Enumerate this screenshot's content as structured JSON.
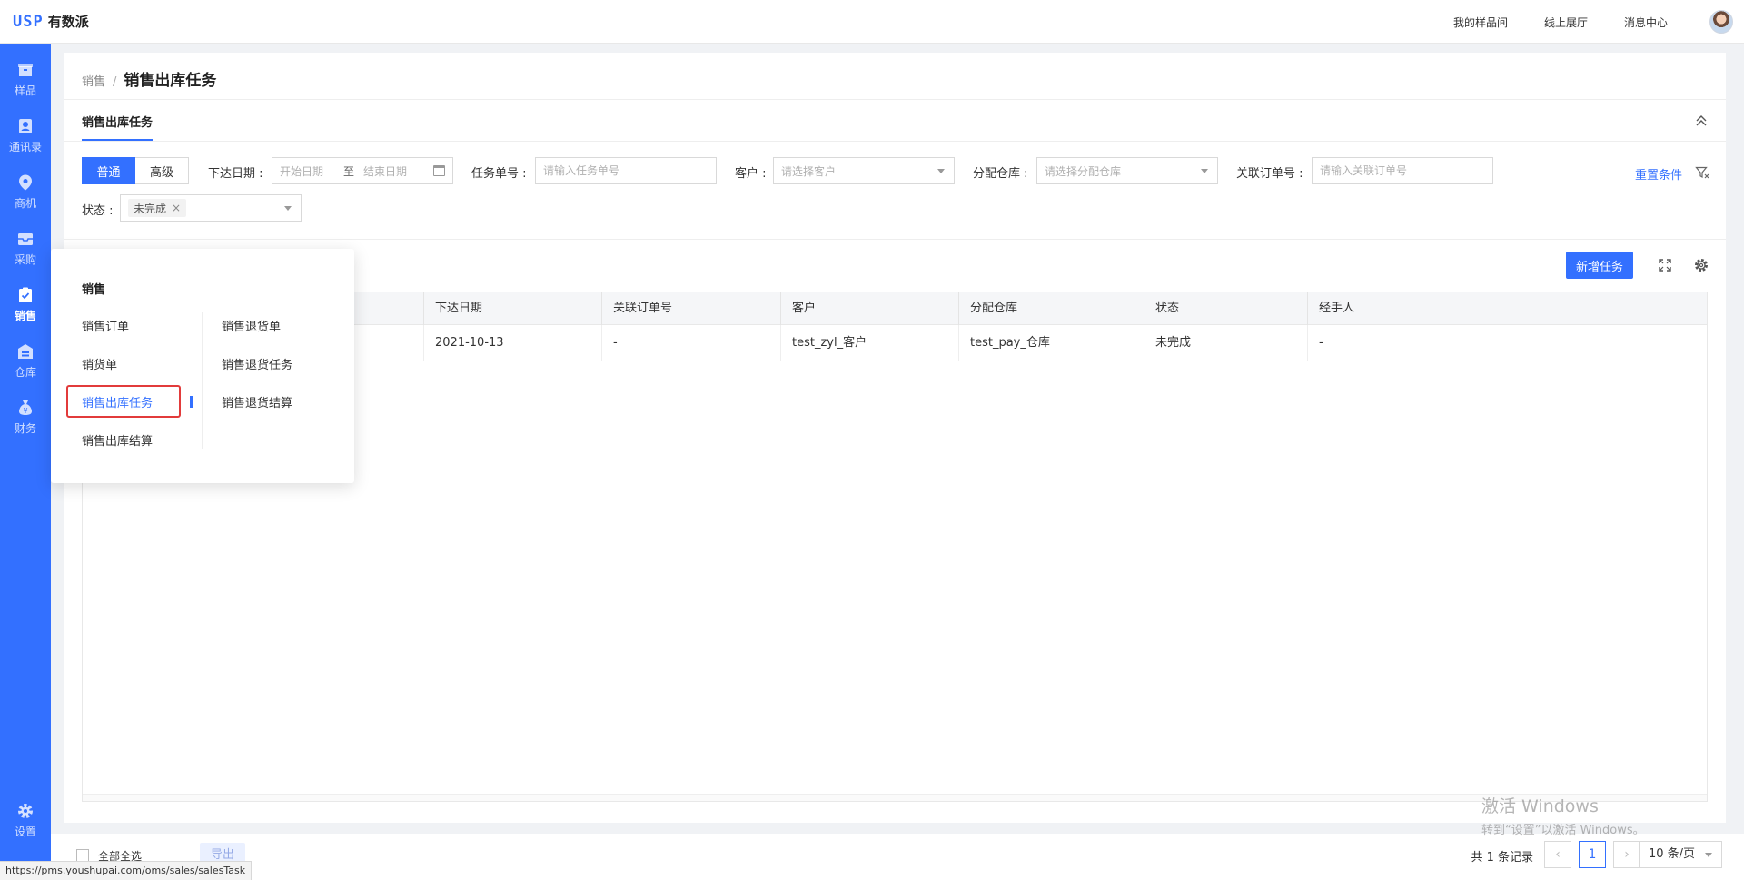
{
  "header": {
    "logo_mark": "USP",
    "logo_text": "有数派",
    "links": [
      "我的样品间",
      "线上展厅",
      "消息中心"
    ]
  },
  "sidebar": {
    "items": [
      {
        "label": "样品",
        "icon": "box-icon"
      },
      {
        "label": "通讯录",
        "icon": "contacts-icon"
      },
      {
        "label": "商机",
        "icon": "location-pin-icon"
      },
      {
        "label": "采购",
        "icon": "inbox-icon"
      },
      {
        "label": "销售",
        "icon": "clipboard-check-icon",
        "active": true
      },
      {
        "label": "仓库",
        "icon": "warehouse-icon"
      },
      {
        "label": "财务",
        "icon": "money-bag-icon"
      }
    ],
    "settings_label": "设置"
  },
  "breadcrumb": {
    "parent": "销售",
    "separator": "/",
    "current": "销售出库任务"
  },
  "tab": {
    "label": "销售出库任务"
  },
  "filters": {
    "mode_normal": "普通",
    "mode_advanced": "高级",
    "issue_date_label": "下达日期 :",
    "start_placeholder": "开始日期",
    "range_sep": "至",
    "end_placeholder": "结束日期",
    "task_no_label": "任务单号 :",
    "task_no_placeholder": "请输入任务单号",
    "customer_label": "客户 :",
    "customer_placeholder": "请选择客户",
    "warehouse_label": "分配仓库 :",
    "warehouse_placeholder": "请选择分配仓库",
    "order_no_label": "关联订单号 :",
    "order_no_placeholder": "请输入关联订单号",
    "status_label": "状态 :",
    "status_tag": "未完成",
    "status_tag_remove": "×",
    "reset_label": "重置条件"
  },
  "toolbar": {
    "add_task_label": "新增任务"
  },
  "table": {
    "columns": [
      "下达日期",
      "关联订单号",
      "客户",
      "分配仓库",
      "状态",
      "经手人"
    ],
    "rows": [
      [
        "2021-10-13",
        "-",
        "test_zyl_客户",
        "test_pay_仓库",
        "未完成",
        "-"
      ]
    ]
  },
  "footer": {
    "select_all_label": "全部全选",
    "export_label": "导出",
    "total_text": "共 1 条记录",
    "prev": "‹",
    "next": "›",
    "current_page": "1",
    "page_size": "10 条/页"
  },
  "flyout": {
    "title": "销售",
    "left_items": [
      "销售订单",
      "销货单",
      "销售出库任务",
      "销售出库结算"
    ],
    "right_items": [
      "销售退货单",
      "销售退货任务",
      "销售退货结算"
    ],
    "active_item": "销售出库任务"
  },
  "status_url": "https://pms.youshupai.com/oms/sales/salesTask",
  "watermark": {
    "line1": "激活 Windows",
    "line2": "转到“设置”以激活 Windows。"
  },
  "colors": {
    "primary": "#3370ff",
    "highlight_border": "#e23b3b"
  }
}
